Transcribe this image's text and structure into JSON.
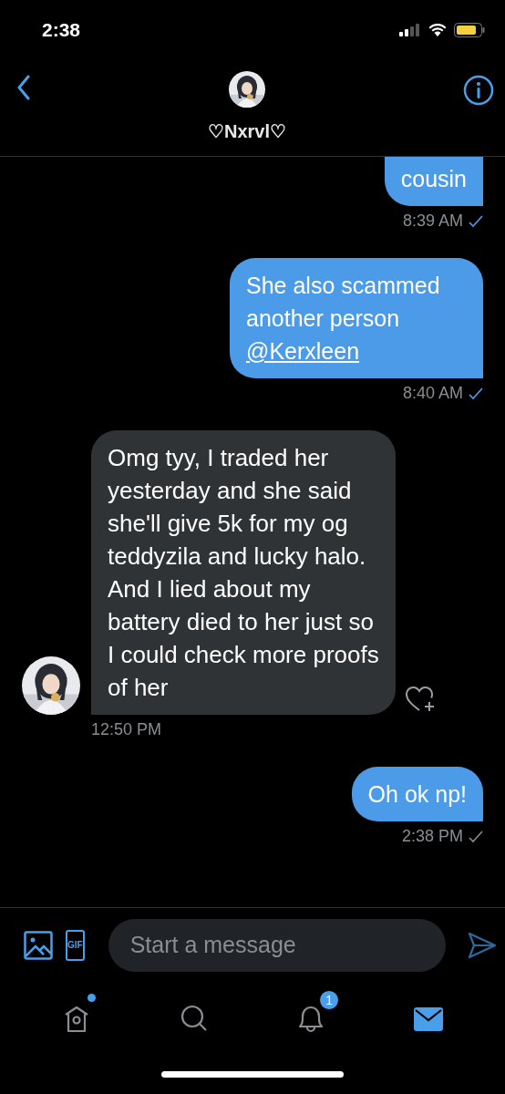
{
  "status_bar": {
    "time": "2:38"
  },
  "header": {
    "title": "♡Nxrvl♡"
  },
  "messages": [
    {
      "kind": "sent",
      "text": "cousin",
      "time": "8:39 AM",
      "read": true
    },
    {
      "kind": "sent",
      "text": "She also scammed another person",
      "link": "@Kerxleen",
      "time": "8:40 AM",
      "read": true
    },
    {
      "kind": "received",
      "text": "Omg tyy, I traded her yesterday and she said she'll give 5k for my og teddyzila and lucky halo. And I lied about my battery died to her just so I could check more proofs of her",
      "time": "12:50 PM",
      "liked": false
    },
    {
      "kind": "sent",
      "text": "Oh ok np!",
      "time": "2:38 PM",
      "read": false
    }
  ],
  "composer": {
    "gif_label": "GIF",
    "placeholder": "Start a message"
  },
  "tab_bar": [
    {
      "kind": "home",
      "selected": false,
      "dot": true
    },
    {
      "kind": "search",
      "selected": false
    },
    {
      "kind": "notifications",
      "selected": false,
      "badge": "1"
    },
    {
      "kind": "messages",
      "selected": true
    }
  ]
}
